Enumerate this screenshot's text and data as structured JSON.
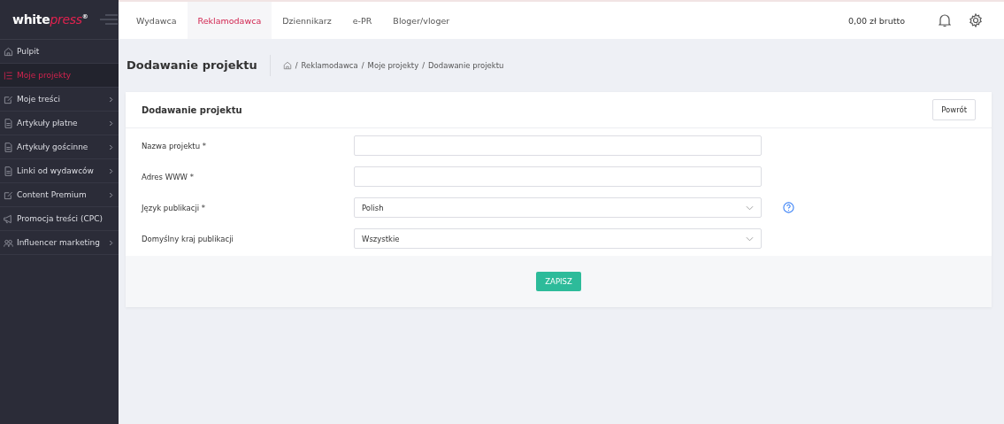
{
  "logo": {
    "main": "white",
    "accent": "press",
    "mark": "®"
  },
  "sidebar": {
    "items": [
      {
        "label": "Pulpit",
        "selected": false,
        "expandable": false
      },
      {
        "label": "Moje projekty",
        "selected": true,
        "expandable": false
      },
      {
        "label": "Moje treści",
        "selected": false,
        "expandable": true
      },
      {
        "label": "Artykuły płatne",
        "selected": false,
        "expandable": true
      },
      {
        "label": "Artykuły gościnne",
        "selected": false,
        "expandable": true
      },
      {
        "label": "Linki od wydawców",
        "selected": false,
        "expandable": true
      },
      {
        "label": "Content Premium",
        "selected": false,
        "expandable": true
      },
      {
        "label": "Promocja treści (CPC)",
        "selected": false,
        "expandable": false
      },
      {
        "label": "Influencer marketing",
        "selected": false,
        "expandable": true
      }
    ]
  },
  "tabs": [
    {
      "label": "Wydawca",
      "selected": false
    },
    {
      "label": "Reklamodawca",
      "selected": true
    },
    {
      "label": "Dziennikarz",
      "selected": false
    },
    {
      "label": "e-PR",
      "selected": false
    },
    {
      "label": "Bloger/vloger",
      "selected": false
    }
  ],
  "balance": "0,00 zł brutto",
  "page_title": "Dodawanie projektu",
  "breadcrumb_separator": "/",
  "breadcrumb": [
    "Reklamodawca",
    "Moje projekty",
    "Dodawanie projektu"
  ],
  "card": {
    "title": "Dodawanie projektu",
    "back_button": "Powrót",
    "fields": [
      {
        "label": "Nazwa projektu *",
        "kind": "input",
        "help": false
      },
      {
        "label": "Adres WWW *",
        "kind": "input",
        "help": false
      },
      {
        "label": "Język publikacji *",
        "kind": "select",
        "value": "Polish",
        "help": true
      },
      {
        "label": "Domyślny kraj publikacji",
        "kind": "select",
        "value": "Wszystkie",
        "help": false
      }
    ],
    "submit": "ZAPISZ"
  }
}
